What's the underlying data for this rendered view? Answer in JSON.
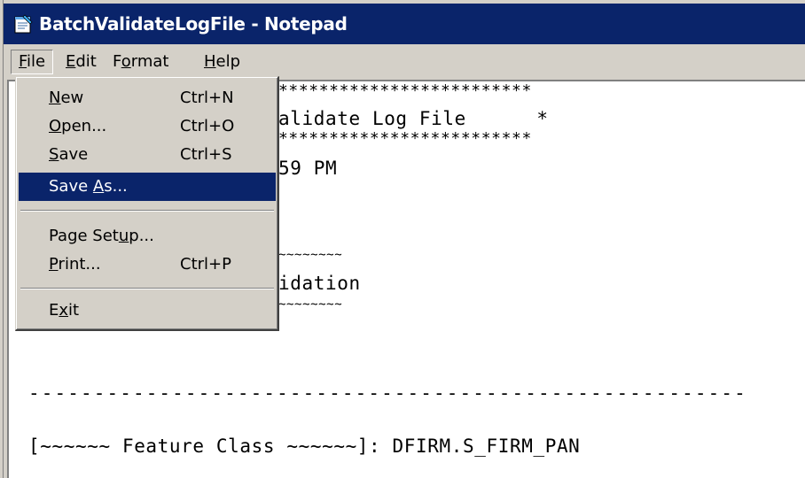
{
  "window": {
    "title": "BatchValidateLogFile - Notepad",
    "app_icon": "notepad-icon"
  },
  "menubar": {
    "items": [
      {
        "label": "File",
        "underline": "F"
      },
      {
        "label": "Edit",
        "underline": "E"
      },
      {
        "label": "Format",
        "underline": "o"
      },
      {
        "label": "Help",
        "underline": "H"
      }
    ]
  },
  "file_menu": {
    "items": [
      {
        "label": "New",
        "shortcut": "Ctrl+N"
      },
      {
        "label": "Open...",
        "shortcut": "Ctrl+O"
      },
      {
        "label": "Save",
        "shortcut": "Ctrl+S"
      },
      {
        "label": "Save As...",
        "shortcut": "",
        "selected": true
      },
      {
        "label": "Page Setup...",
        "shortcut": ""
      },
      {
        "label": "Print...",
        "shortcut": "Ctrl+P"
      },
      {
        "label": "Exit",
        "shortcut": ""
      }
    ]
  },
  "editor": {
    "lines": [
      "*************************",
      "alidate Log File      *",
      "*************************",
      "59 PM",
      "~~~~~~~~",
      "idation",
      "~~~~~~~~",
      "-------------------------------------------------------",
      "[~~~~~~ Feature Class ~~~~~~]: DFIRM.S_FIRM_PAN"
    ]
  },
  "colors": {
    "titlebar": "#0a246a",
    "chrome": "#d4d0c8",
    "selection": "#0a246a"
  }
}
